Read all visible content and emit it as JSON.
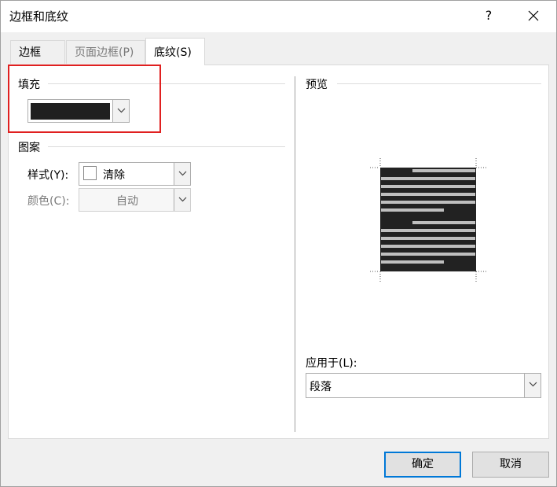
{
  "window": {
    "title": "边框和底纹",
    "help_label": "?",
    "close_label": "✕"
  },
  "tabs": [
    {
      "label": "边框(B)",
      "state": "normal"
    },
    {
      "label": "页面边框(P)",
      "state": "disabled"
    },
    {
      "label": "底纹(S)",
      "state": "active"
    }
  ],
  "fill": {
    "group_label": "填充",
    "color": "#1f1f1f"
  },
  "pattern": {
    "group_label": "图案",
    "style_label": "样式(Y):",
    "style_value": "清除",
    "color_label": "颜色(C):",
    "color_value": "自动"
  },
  "preview": {
    "group_label": "预览"
  },
  "apply_to": {
    "label": "应用于(L):",
    "value": "段落"
  },
  "buttons": {
    "ok": "确定",
    "cancel": "取消"
  },
  "colors": {
    "highlight": "#e02020",
    "accent": "#0078d7",
    "preview_bg": "#222222"
  }
}
